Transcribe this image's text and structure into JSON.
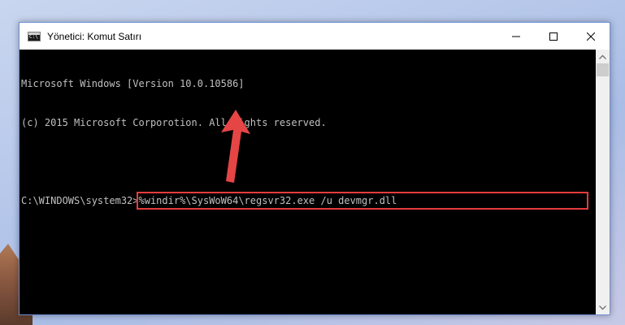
{
  "window": {
    "title": "Yönetici: Komut Satırı",
    "icons": {
      "app": "cmd-icon",
      "minimize": "minimize-icon",
      "maximize": "maximize-icon",
      "close": "close-icon"
    }
  },
  "console": {
    "lines": [
      "Microsoft Windows [Version 10.0.10586]",
      "(c) 2015 Microsoft Corporotion. All rights reserved.",
      ""
    ],
    "prompt": "C:\\WINDOWS\\system32>",
    "command": "%windir%\\SysWoW64\\regsvr32.exe /u devmgr.dll"
  },
  "colors": {
    "console_bg": "#000000",
    "console_text": "#c0c0c0",
    "highlight": "#e63b3b",
    "arrow": "#e64545"
  }
}
